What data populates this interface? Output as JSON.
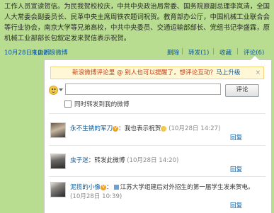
{
  "post": {
    "text": "工作人员宣读贺信。为民我贺校校庆，中共中央政治局常委、国务院原副总理李岚清，全国人大常委会副委员长、民革中央主席周铁农题词祝贺。教育部办公厅，中国机械工业联合会等行业协会，南京大学等兄弟高校，中共中央委员、交通运输部部长、党组书记李盛霖，原机械工业部部长包叙定发来贺信表示祝贺。"
  },
  "meta": {
    "time": "10月28日 10:27",
    "source": "来自新浪微博",
    "delete": "删除",
    "forward": "转发(1)",
    "favorite": "收藏",
    "comment": "评论(6)",
    "sep": "|"
  },
  "comment_box": {
    "banner_text": "新浪微博评论里 @ 别人也可以提醒了，想评论互动？",
    "banner_link": "马上升级",
    "close": "×",
    "input_placeholder": "",
    "submit_label": "评论",
    "also_forward_label": "同时转发到我的微博"
  },
  "comments": [
    {
      "user": "永不生锈的军刀",
      "text": "我也表示祝贺",
      "time": "(10月28日 14:27)",
      "reply": "回复"
    },
    {
      "user": "虫子迷",
      "text": "转发此微博",
      "time": "(10月28日 14:20)",
      "reply": "回复"
    },
    {
      "user": "泥揽的小像",
      "text": "江苏大学组建后对外招生的第一届学生发来贺电。",
      "time": "(10月28日 10:39)",
      "reply": "回复"
    }
  ],
  "colors": {
    "page_bg": "#b8dc90",
    "link": "#0a5a9c",
    "banner_bg": "#fff7d6",
    "banner_text": "#c0401a"
  },
  "icons": [
    "smiley-icon",
    "verified-badge-icon",
    "image-icon",
    "checkbox-icon",
    "close-icon"
  ]
}
